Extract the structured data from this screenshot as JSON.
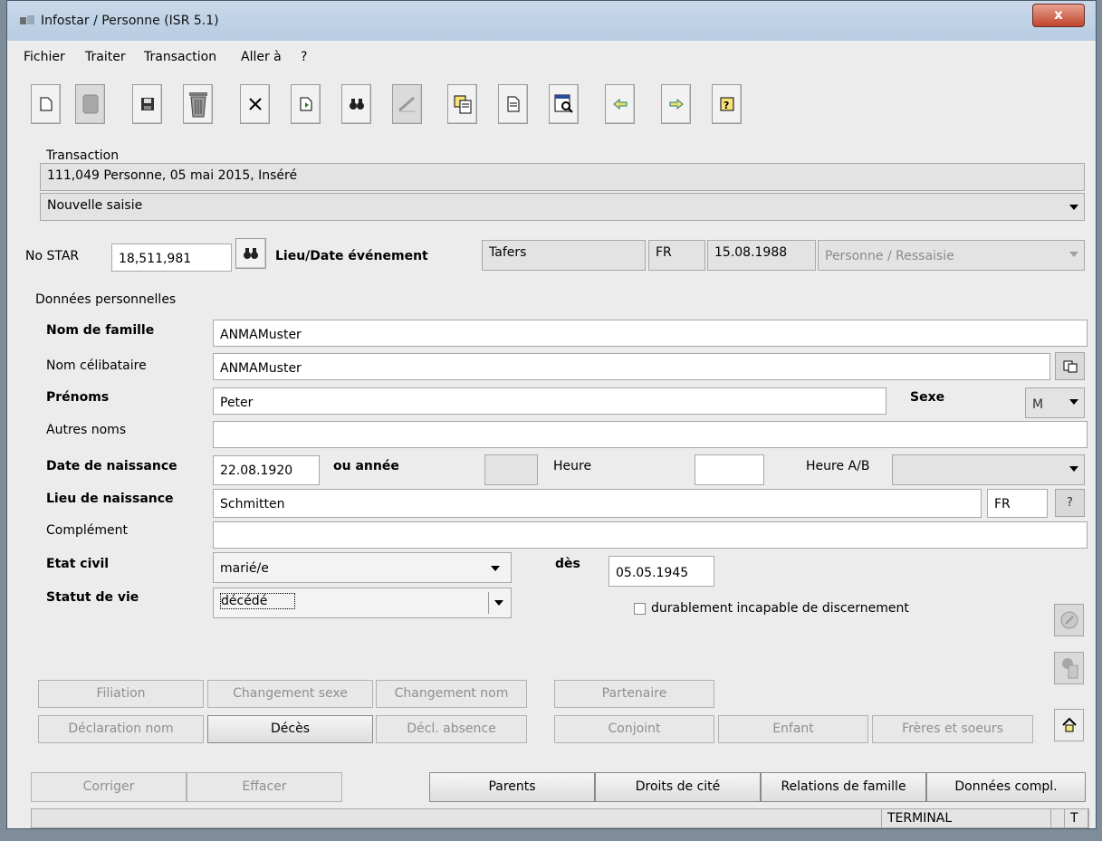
{
  "window": {
    "title": "Infostar / Personne (ISR 5.1)",
    "close_glyph": "x"
  },
  "menu": [
    "Fichier",
    "Traiter",
    "Transaction",
    "Aller à",
    "?"
  ],
  "toolbar": {
    "icons": [
      "new-icon",
      "copy-disabled-icon",
      "save-icon",
      "trash-icon",
      "close-icon",
      "import-icon",
      "search-binoculars-icon",
      "sign-disabled-icon",
      "paste-icon",
      "document-icon",
      "preview-icon",
      "back-arrow-icon",
      "forward-arrow-icon",
      "help-icon"
    ]
  },
  "transaction": {
    "label": "Transaction",
    "info": "111,049 Personne, 05 mai 2015, Inséré",
    "mode": "Nouvelle saisie"
  },
  "star": {
    "label": "No STAR",
    "number": "18,511,981",
    "event_label": "Lieu/Date événement",
    "event_place": "Tafers",
    "event_canton": "FR",
    "event_date": "15.08.1988",
    "event_type": "Personne / Ressaisie"
  },
  "personal": {
    "section_label": "Données personnelles",
    "nom_famille": {
      "label": "Nom de famille",
      "value": "ANMAMuster"
    },
    "nom_celibataire": {
      "label": "Nom célibataire",
      "value": "ANMAMuster"
    },
    "prenoms": {
      "label": "Prénoms",
      "value": "Peter"
    },
    "sexe": {
      "label": "Sexe",
      "value": "M"
    },
    "autres_noms": {
      "label": "Autres noms",
      "value": ""
    },
    "date_naissance": {
      "label": "Date de naissance",
      "value": "22.08.1920"
    },
    "ou_annee": {
      "label": "ou année",
      "value": ""
    },
    "heure": {
      "label": "Heure",
      "value": ""
    },
    "heure_ab": {
      "label": "Heure A/B",
      "value": ""
    },
    "lieu_naissance": {
      "label": "Lieu de naissance",
      "value": "Schmitten",
      "canton": "FR",
      "help": "?"
    },
    "complement": {
      "label": "Complément",
      "value": ""
    },
    "etat_civil": {
      "label": "Etat civil",
      "value": "marié/e"
    },
    "des": {
      "label": "dès",
      "value": "05.05.1945"
    },
    "statut_vie": {
      "label": "Statut de vie",
      "value": "décédé"
    },
    "incapable": {
      "label": "durablement incapable de discernement",
      "checked": false
    }
  },
  "actions_row1": [
    "Filiation",
    "Changement sexe",
    "Changement nom",
    "Partenaire"
  ],
  "actions_row2": [
    "Déclaration nom",
    "Décès",
    "Décl. absence",
    "Conjoint",
    "Enfant",
    "Frères et soeurs"
  ],
  "bottom_buttons": [
    "Corriger",
    "Effacer",
    "Parents",
    "Droits de cité",
    "Relations de famille",
    "Données compl."
  ],
  "status": {
    "terminal": "TERMINAL",
    "mode": "T"
  },
  "colors": {
    "window_bg": "#ececec",
    "field_bg": "#ffffff",
    "readonly_bg": "#e3e3e3",
    "close_red": "#c0452c"
  }
}
